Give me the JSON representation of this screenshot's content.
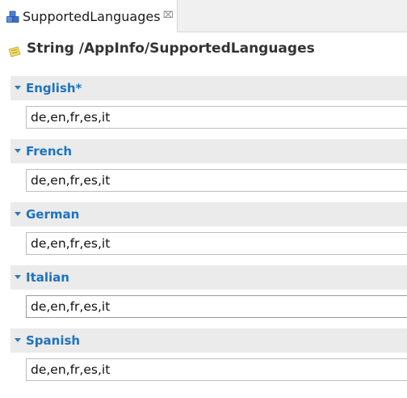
{
  "tab": {
    "label": "SupportedLanguages",
    "close_glyph": "⌧",
    "icon": "package-cubes-icon"
  },
  "header": {
    "title": "String /AppInfo/SupportedLanguages",
    "icon": "string-note-icon"
  },
  "sections": [
    {
      "label": "English*",
      "value": "de,en,fr,es,it",
      "expanded": true
    },
    {
      "label": "French",
      "value": "de,en,fr,es,it",
      "expanded": true
    },
    {
      "label": "German",
      "value": "de,en,fr,es,it",
      "expanded": true
    },
    {
      "label": "Italian",
      "value": "de,en,fr,es,it",
      "expanded": true,
      "focused": true
    },
    {
      "label": "Spanish",
      "value": "de,en,fr,es,it",
      "expanded": true
    }
  ],
  "colors": {
    "section_label": "#1e73be",
    "section_bar": "#ebebeb",
    "tab_background": "#f0f0f0"
  }
}
